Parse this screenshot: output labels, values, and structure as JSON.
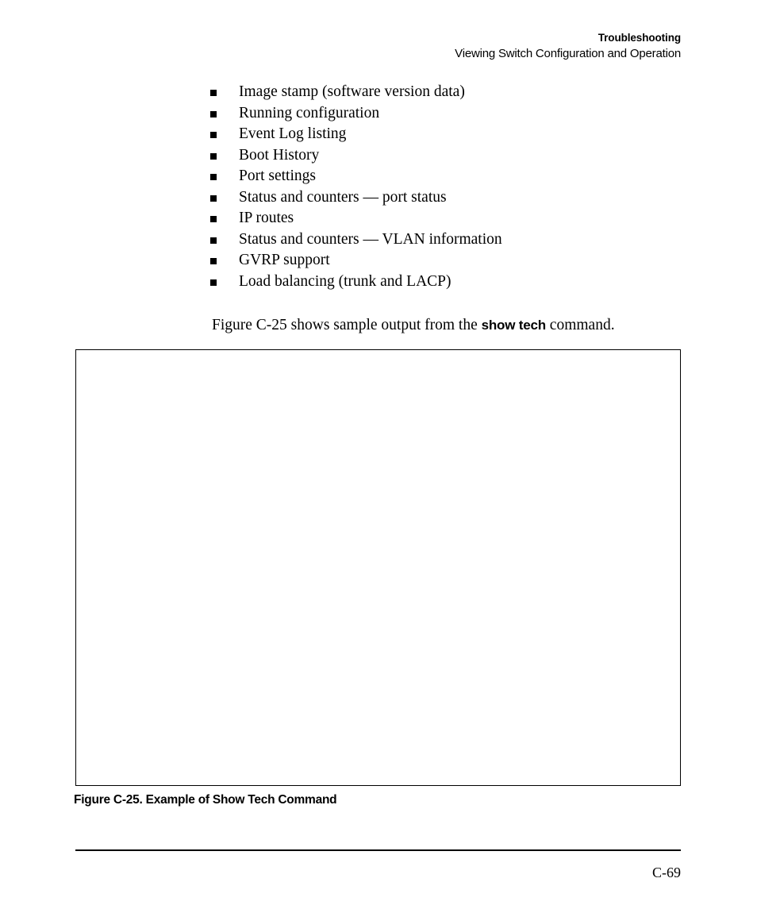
{
  "header": {
    "title": "Troubleshooting",
    "subtitle": "Viewing Switch Configuration and Operation"
  },
  "bullets": [
    {
      "label": "Image stamp (software version data)"
    },
    {
      "label": "Running configuration"
    },
    {
      "label": "Event Log listing"
    },
    {
      "label": "Boot History"
    },
    {
      "label": "Port settings"
    },
    {
      "label": "Status and counters — port status"
    },
    {
      "label": "IP routes"
    },
    {
      "label": "Status and counters — VLAN information"
    },
    {
      "label": "GVRP support"
    },
    {
      "label": "Load balancing (trunk and LACP)"
    }
  ],
  "paragraph": {
    "before": "Figure C-25 shows sample output from the ",
    "command": "show tech",
    "after": " command."
  },
  "figure": {
    "caption": "Figure C-25. Example of Show Tech Command",
    "content": ""
  },
  "footer": {
    "page_number": "C-69"
  }
}
